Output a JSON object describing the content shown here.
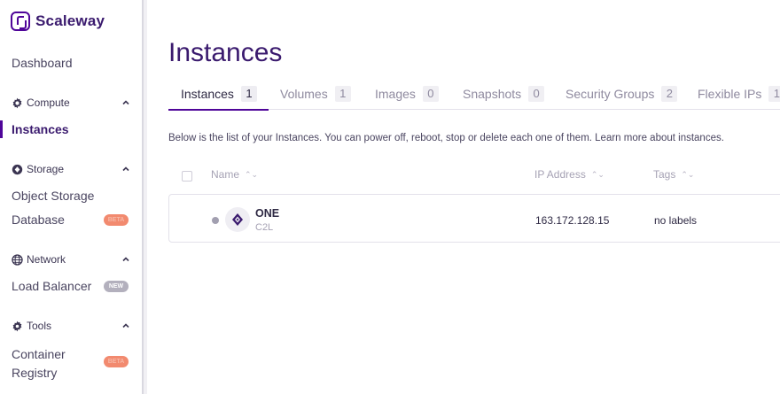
{
  "brand": {
    "name": "Scaleway",
    "accent": "#4f0599"
  },
  "sidebar": {
    "dashboard": "Dashboard",
    "sections": [
      {
        "title": "Compute",
        "icon": "gear-icon",
        "items": [
          {
            "label": "Instances",
            "active": true
          }
        ]
      },
      {
        "title": "Storage",
        "icon": "storage-icon",
        "items": [
          {
            "label": "Object Storage"
          },
          {
            "label": "Database",
            "badge": "BETA"
          }
        ]
      },
      {
        "title": "Network",
        "icon": "globe-icon",
        "items": [
          {
            "label": "Load Balancer",
            "badge": "NEW"
          }
        ]
      },
      {
        "title": "Tools",
        "icon": "tools-icon",
        "items": [
          {
            "label": "Container Registry",
            "badge": "BETA"
          }
        ]
      }
    ]
  },
  "main": {
    "title": "Instances",
    "tabs": [
      {
        "label": "Instances",
        "count": "1",
        "active": true
      },
      {
        "label": "Volumes",
        "count": "1"
      },
      {
        "label": "Images",
        "count": "0"
      },
      {
        "label": "Snapshots",
        "count": "0"
      },
      {
        "label": "Security Groups",
        "count": "2"
      },
      {
        "label": "Flexible IPs",
        "count": "1"
      }
    ],
    "description": "Below is the list of your Instances. You can power off, reboot, stop or delete each one of them. Learn more about instances.",
    "table": {
      "columns": {
        "name": "Name",
        "ip": "IP Address",
        "tags": "Tags"
      },
      "sort_glyph": "⌃⌄",
      "rows": [
        {
          "name": "ONE",
          "type": "C2L",
          "ip": "163.172.128.15",
          "tags": "no labels"
        }
      ]
    }
  }
}
